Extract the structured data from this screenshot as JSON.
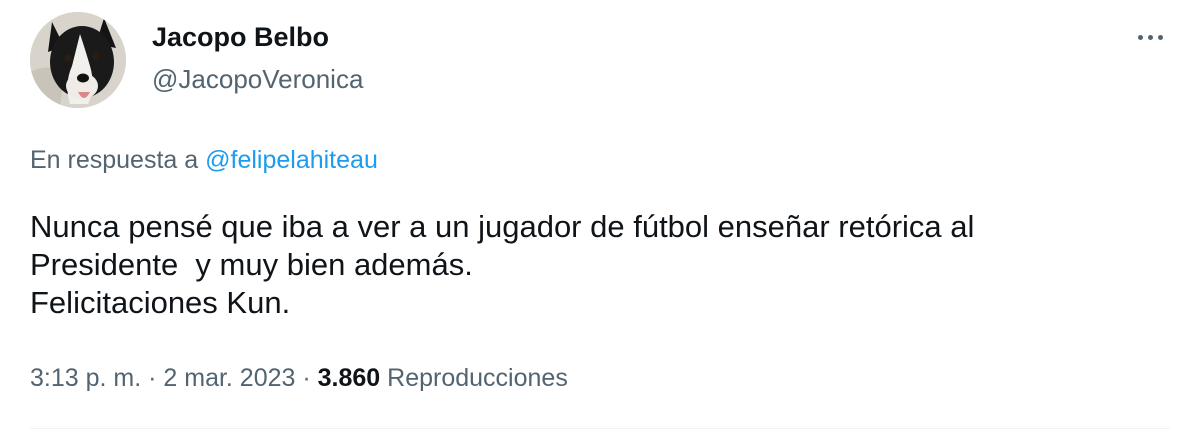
{
  "author": {
    "display_name": "Jacopo Belbo",
    "handle": "@JacopoVeronica",
    "avatar_icon": "border-collie-avatar"
  },
  "more_icon": "more-horizontal-icon",
  "reply": {
    "prefix": "En respuesta a ",
    "mention": "@felipelahiteau"
  },
  "tweet": {
    "lines": [
      "Nunca pensé que iba a ver a un jugador de fútbol enseñar retórica al",
      "Presidente  y muy bien además.",
      "Felicitaciones Kun."
    ]
  },
  "meta": {
    "time": "3:13 p. m.",
    "separator": " · ",
    "date": "2 mar. 2023",
    "views_count": "3.860",
    "views_label": " Reproducciones"
  },
  "colors": {
    "text_primary": "#0f1419",
    "text_secondary": "#536471",
    "link": "#1d9bf0",
    "divider": "#eff3f4"
  }
}
